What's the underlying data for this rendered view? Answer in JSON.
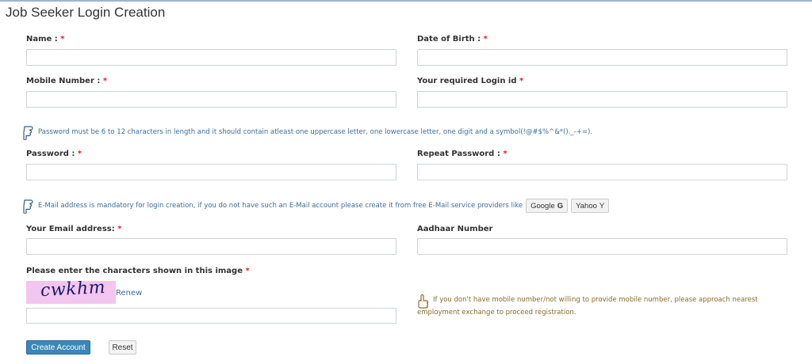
{
  "page": {
    "title": "Job Seeker Login Creation"
  },
  "form": {
    "name_label": "Name :",
    "dob_label": "Date of Birth :",
    "mobile_label": "Mobile Number :",
    "login_id_label": "Your required Login id",
    "password_note": "Password must be 6 to 12 characters in length and it should contain atleast one uppercase letter, one lowercase letter, one digit and a symbol(!@#$%^&*()._-+=).",
    "password_label": "Password :",
    "repeat_password_label": "Repeat Password :",
    "email_note": "E-Mail address is mandatory for login creation, if you do not have such an E-Mail account please create it from free E-Mail service providers like",
    "providers": {
      "google": "Google",
      "google_icon": "G",
      "yahoo": "Yahoo",
      "yahoo_icon": "Y"
    },
    "email_label": "Your Email address:",
    "aadhaar_label": "Aadhaar Number",
    "captcha_label": "Please enter the characters shown in this image",
    "captcha_text": "cwkhm",
    "renew_label": "Renew",
    "mobile_info": "If you don't have mobile number/not willing to provide mobile number, please approach nearest employment exchange to proceed registration.",
    "required_mark": "*"
  },
  "buttons": {
    "create": "Create Account",
    "reset": "Reset"
  },
  "colors": {
    "required": "#d9232d",
    "link": "#3b6f9a",
    "primary": "#3b87b8",
    "info": "#8a6d2b"
  }
}
